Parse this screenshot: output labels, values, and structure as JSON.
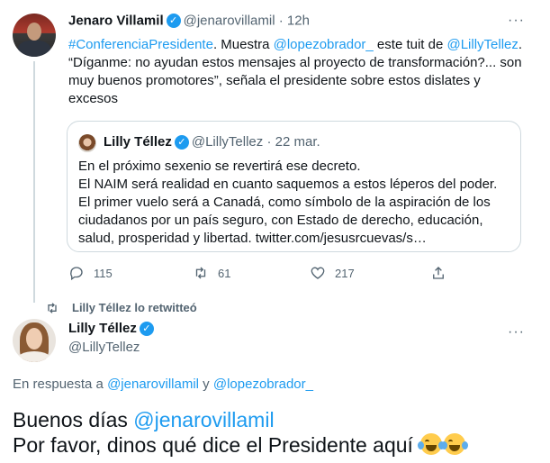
{
  "main_tweet": {
    "author_name": "Jenaro Villamil",
    "handle": "@jenarovillamil",
    "separator": "·",
    "time": "12h",
    "more": "···",
    "text_parts": {
      "hashtag": "#ConferenciaPresidente",
      "t1": ". Muestra ",
      "mention1": "@lopezobrador_",
      "t2": " este tuit de ",
      "mention2": "@LillyTellez",
      "t3": ".",
      "t4": "“Díganme: no ayudan estos mensajes al proyecto de transformación?... son muy buenos promotores”, señala el presidente sobre estos dislates y excesos"
    },
    "quote": {
      "author_name": "Lilly Téllez",
      "handle": "@LillyTellez",
      "separator": "·",
      "date": "22 mar.",
      "line1": "En el próximo sexenio se revertirá ese decreto.",
      "line2": "El NAIM será realidad en cuanto saquemos a estos léperos del poder. El primer vuelo será a Canadá, como símbolo de la aspiración de los ciudadanos por un país seguro, con Estado de derecho, educación, salud, prosperidad y libertad. twitter.com/jesusrcuevas/s…"
    },
    "actions": {
      "replies": "115",
      "retweets": "61",
      "likes": "217"
    }
  },
  "retweet_notice": "Lilly Téllez lo retwitteó",
  "reply_tweet": {
    "author_name": "Lilly Téllez",
    "handle": "@LillyTellez",
    "more": "···",
    "reply_prefix": "En respuesta a ",
    "reply_to1": "@jenarovillamil",
    "reply_and": " y ",
    "reply_to2": "@lopezobrador_",
    "greeting": "Buenos días ",
    "greeting_mention": "@jenarovillamil",
    "line2": "Por favor, dinos qué dice el Presidente aquí ",
    "emoji_name": "face-with-tears-of-joy-icon"
  },
  "colors": {
    "link": "#1d9bf0",
    "secondary": "#536471",
    "text": "#0f1419",
    "border": "#cfd9de"
  }
}
